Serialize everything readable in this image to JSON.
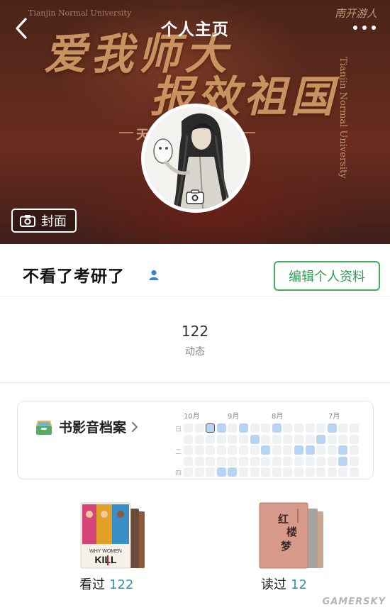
{
  "nav": {
    "title": "个人主页",
    "back_icon": "chevron-left-icon",
    "more_icon": "more-dots-icon"
  },
  "cover": {
    "slogan_line1": "爱我师大",
    "slogan_line2": "报效祖国",
    "university_en": "Tianjin Normal University",
    "side_char": "天",
    "brand": "南开游人",
    "button_label": "封面",
    "button_icon": "camera-icon"
  },
  "profile": {
    "username": "不看了考研了",
    "user_icon": "person-icon",
    "edit_button": "编辑个人资料",
    "avatar_icon": "camera-icon"
  },
  "stats": {
    "value": "122",
    "label": "动态"
  },
  "archive": {
    "title": "书影音档案",
    "title_icon": "archive-box-icon",
    "chevron_icon": "chevron-right-icon",
    "months": [
      "10月",
      "9月",
      "8月",
      "7月"
    ],
    "row_labels": [
      "日",
      "二",
      "四"
    ],
    "accent_color": "#b7d4f4"
  },
  "shelves": [
    {
      "label": "看过",
      "count": "122",
      "cover_text": "WHY WOMEN KILL"
    },
    {
      "label": "读过",
      "count": "12",
      "cover_text": "红楼梦"
    }
  ],
  "watermark": "GAMERSKY",
  "colors": {
    "accent_green": "#3fae61",
    "count_blue": "#3a8fb7"
  }
}
